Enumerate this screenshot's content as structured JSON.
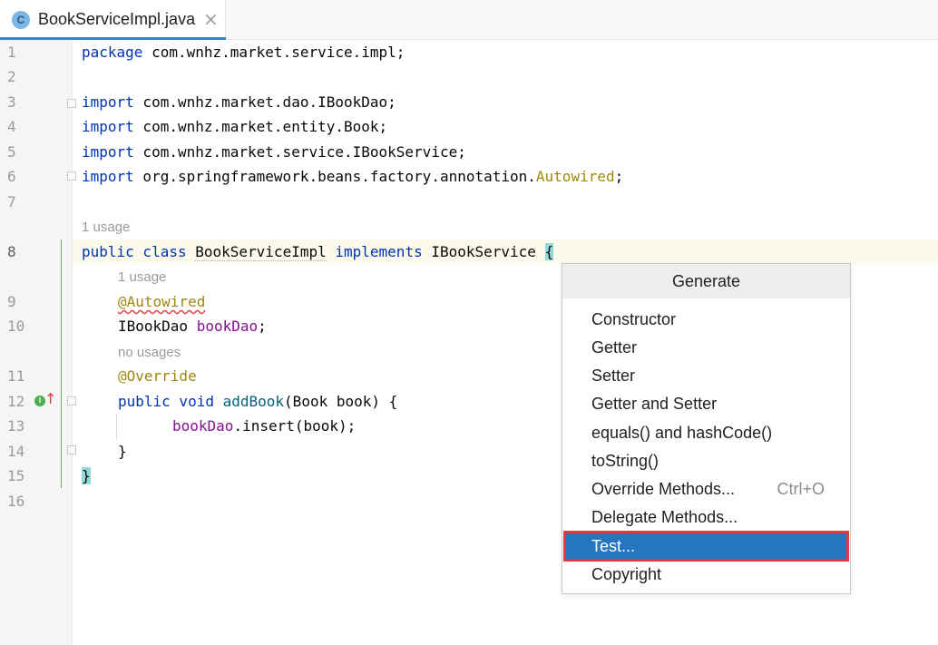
{
  "tab": {
    "icon_letter": "C",
    "title": "BookServiceImpl.java",
    "close_glyph": "×"
  },
  "lines": {
    "numbers": [
      "1",
      "2",
      "3",
      "4",
      "5",
      "6",
      "7",
      "8",
      "9",
      "10",
      "11",
      "12",
      "13",
      "14",
      "15",
      "16"
    ],
    "l1": {
      "kw": "package",
      "rest": " com.wnhz.market.service.impl;"
    },
    "l3": {
      "kw": "import",
      "rest": " com.wnhz.market.dao.IBookDao;"
    },
    "l4": {
      "kw": "import",
      "rest": " com.wnhz.market.entity.Book;"
    },
    "l5": {
      "kw": "import",
      "rest": " com.wnhz.market.service.IBookService;"
    },
    "l6": {
      "kw": "import",
      "rest": " org.springframework.beans.factory.annotation.",
      "ann": "Autowired",
      "end": ";"
    },
    "l8": {
      "kw1": "public class",
      "name": "BookServiceImpl",
      "kw2": "implements",
      "iface": "IBookService",
      "brace": "{"
    },
    "l9": {
      "ann": "@Autowired"
    },
    "l10": {
      "type": "IBookDao",
      "field": "bookDao",
      "end": ";"
    },
    "l11": {
      "ann": "@Override"
    },
    "l12": {
      "kw": "public void",
      "method": "addBook",
      "params": "(Book book) {"
    },
    "l13": {
      "field": "bookDao",
      "call": ".insert(book);"
    },
    "l14": {
      "text": "}"
    },
    "l15": {
      "text": "}"
    }
  },
  "hints": {
    "class_usage": "1 usage",
    "field_usage": "1 usage",
    "method_usage": "no usages"
  },
  "gutter_icons": {
    "implements_icon": "I",
    "override_arrow": "↑"
  },
  "popup": {
    "title": "Generate",
    "items": [
      {
        "label": "Constructor",
        "shortcut": ""
      },
      {
        "label": "Getter",
        "shortcut": ""
      },
      {
        "label": "Setter",
        "shortcut": ""
      },
      {
        "label": "Getter and Setter",
        "shortcut": ""
      },
      {
        "label": "equals() and hashCode()",
        "shortcut": ""
      },
      {
        "label": "toString()",
        "shortcut": ""
      },
      {
        "label": "Override Methods...",
        "shortcut": "Ctrl+O"
      },
      {
        "label": "Delegate Methods...",
        "shortcut": ""
      },
      {
        "label": "Test...",
        "shortcut": "",
        "selected": true
      },
      {
        "label": "Copyright",
        "shortcut": ""
      }
    ]
  },
  "colors": {
    "keyword": "#0033b3",
    "annotation": "#9e880d",
    "field": "#871094",
    "method": "#00627a",
    "selection": "#2675bf",
    "selection_border": "#e03c3c"
  }
}
